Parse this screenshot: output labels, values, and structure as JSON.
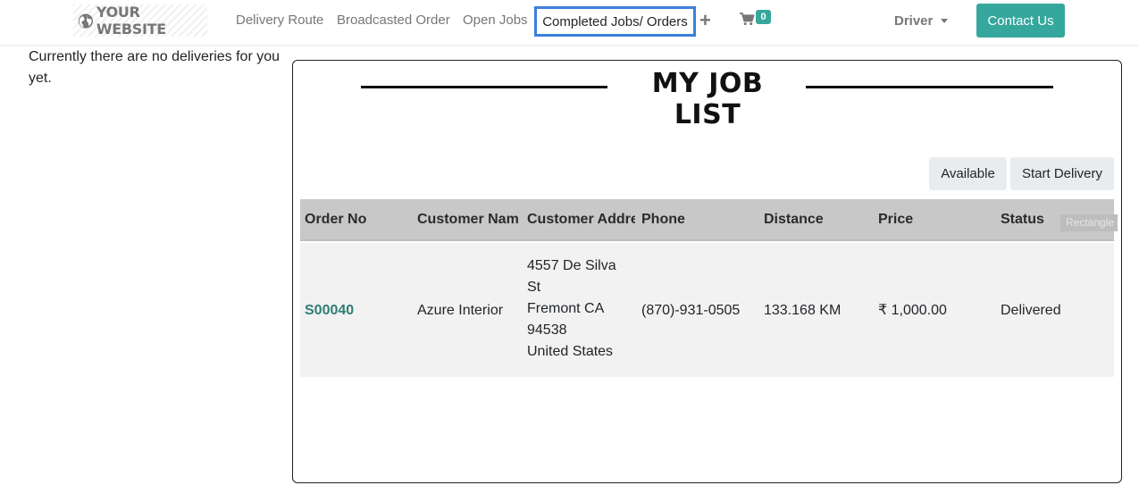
{
  "header": {
    "logo_text": "YOUR WEBSITE",
    "nav": {
      "delivery_route": "Delivery Route",
      "broadcasted_order": "Broadcasted Order",
      "open_jobs": "Open Jobs",
      "completed_jobs": "Completed Jobs/ Orders"
    },
    "cart_count": "0",
    "user_menu": "Driver",
    "contact_button": "Contact Us",
    "icons": [
      "globe-icon",
      "plus-icon",
      "cart-icon",
      "caret-down-icon"
    ]
  },
  "sidebar": {
    "message": "Currently there are no deliveries for you yet."
  },
  "job_list": {
    "title": "MY JOB LIST",
    "buttons": {
      "available": "Available",
      "start_delivery": "Start Delivery"
    },
    "columns": {
      "order_no": "Order No",
      "customer_name": "Customer Name",
      "customer_address": "Customer Address",
      "phone": "Phone",
      "distance": "Distance",
      "price": "Price",
      "status": "Status"
    },
    "overlay_label": "Rectangle",
    "rows": [
      {
        "order_no": "S00040",
        "customer_name": "Azure Interior",
        "address": [
          "4557 De Silva",
          "St",
          "Fremont CA",
          "94538",
          "United States"
        ],
        "phone": "(870)-931-0505",
        "distance": "133.168 KM",
        "price": "₹ 1,000.00",
        "status": "Delivered"
      }
    ]
  },
  "colors": {
    "accent": "#35a79c",
    "link": "#2e7d75",
    "active_outline": "#3b7fdc",
    "table_header": "#c8c8c8",
    "table_row": "#f2f2f2"
  }
}
